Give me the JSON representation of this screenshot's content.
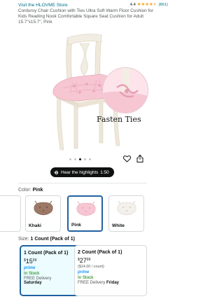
{
  "header": {
    "store_link": "Visit the HLOVME Store",
    "rating_value": "4.4",
    "rating_fraction": 0.88,
    "rating_count": "(861)",
    "product_title": "Corduroy Chair Cushion with Ties Ultra Soft Warm Floor Cushion for Kids Reading Nook Comfortable Square Seat Cushion for Adult 15.7\"x15.7\", Pink"
  },
  "gallery": {
    "caption": "Fasten Ties",
    "dot_count": 5,
    "active_dot": 2
  },
  "highlights": {
    "label": "Hear the highlights",
    "duration": "1:50"
  },
  "color_selector": {
    "label": "Color:",
    "selected": "Pink",
    "options": [
      {
        "label": "Khaki",
        "swatch": "#9c7866"
      },
      {
        "label": "Pink",
        "swatch": "#f7c6d3"
      },
      {
        "label": "White",
        "swatch": "#f4f1ec"
      }
    ]
  },
  "size_selector": {
    "label": "Size:",
    "selected": "1 Count (Pack of 1)",
    "options": [
      {
        "name": "1 Count (Pack of 1)",
        "price_symbol": "$",
        "price_whole": "15",
        "price_fraction": "99",
        "unit_price": "",
        "prime": "prime",
        "stock": "In Stock",
        "delivery_prefix": "FREE Delivery",
        "delivery_day": "Saturday"
      },
      {
        "name": "2 Count (Pack of 1)",
        "price_symbol": "$",
        "price_whole": "27",
        "price_fraction": "99",
        "unit_price": "($14.00 / count)",
        "prime": "prime",
        "stock": "In Stock",
        "delivery_prefix": "FREE Delivery",
        "delivery_day": "Friday"
      }
    ]
  },
  "colors": {
    "link": "#007185",
    "selected_border": "#2162a1",
    "in_stock": "#007600",
    "star": "#ffa41c",
    "prime": "#1a98ff"
  }
}
